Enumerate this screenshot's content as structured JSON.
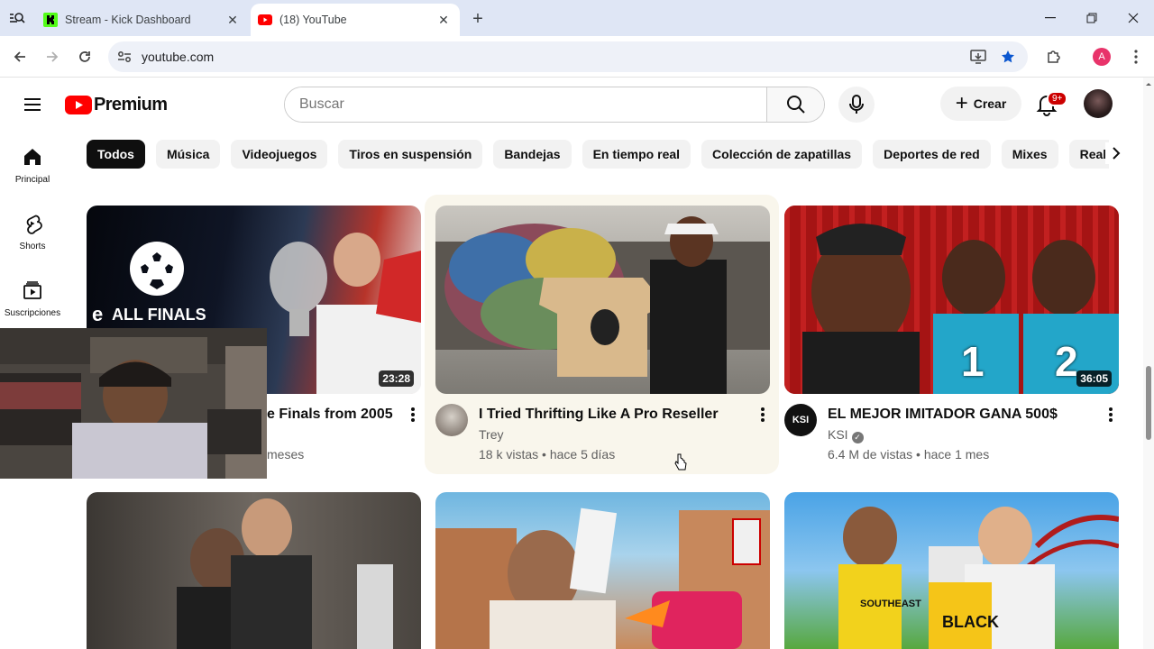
{
  "browser": {
    "tabs": [
      {
        "title": "Stream - Kick Dashboard",
        "active": false
      },
      {
        "title": "(18) YouTube",
        "active": true
      }
    ],
    "address": "youtube.com",
    "profile_initial": "A"
  },
  "header": {
    "logo_text": "Premium",
    "search_placeholder": "Buscar",
    "create_label": "Crear",
    "notification_count": "9+"
  },
  "chips": [
    "Todos",
    "Música",
    "Videojuegos",
    "Tiros en suspensión",
    "Bandejas",
    "En tiempo real",
    "Colección de zapatillas",
    "Deportes de red",
    "Mixes",
    "Real Madric"
  ],
  "sidebar": [
    {
      "label": "Principal",
      "icon": "home-icon"
    },
    {
      "label": "Shorts",
      "icon": "shorts-icon"
    },
    {
      "label": "Suscripciones",
      "icon": "subscriptions-icon"
    }
  ],
  "videos": [
    {
      "title": "e Finals from 2005",
      "meta": "meses",
      "duration": "23:28",
      "thumb_text": "ALL FINALS",
      "thumb_text_left": "e"
    },
    {
      "title": "I Tried Thrifting Like A Pro Reseller",
      "channel": "Trey",
      "meta": "18 k vistas • hace 5 días"
    },
    {
      "title": "EL MEJOR IMITADOR GANA 500$",
      "channel": "KSI",
      "channel_avatar_text": "KSI",
      "meta": "6.4 M de vistas • hace 1 mes",
      "duration": "36:05",
      "thumb_numbers": [
        "1",
        "2"
      ]
    },
    {
      "title": "",
      "meta": ""
    },
    {
      "title": "",
      "meta": ""
    },
    {
      "title": "",
      "meta": "",
      "jersey_text": [
        "SOUTHEAST",
        "BLACK"
      ]
    }
  ],
  "colors": {
    "yt_red": "#ff0000",
    "chip_selected": "#0f0f0f",
    "badge": "#cc0000",
    "hover_card": "#f9f6ec"
  }
}
